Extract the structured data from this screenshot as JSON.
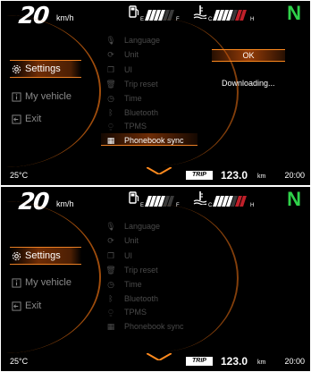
{
  "speed": {
    "value": "20",
    "unit": "km/h"
  },
  "fuel_gauge": {
    "icon": "fuel-pump-icon",
    "empty_label": "E",
    "full_label": "F",
    "filled_bars": 4,
    "total_bars": 6
  },
  "temp_gauge": {
    "icon": "coolant-temp-icon",
    "cold_label": "C",
    "hot_label": "H",
    "filled_bars": 4,
    "total_bars": 7
  },
  "gear": {
    "value": "N",
    "color": "#2fd24a"
  },
  "side_menu": [
    {
      "label": "Settings",
      "icon": "gear-icon",
      "active": true
    },
    {
      "label": "My vehicle",
      "icon": "info-icon",
      "active": false
    },
    {
      "label": "Exit",
      "icon": "exit-icon",
      "active": false
    }
  ],
  "settings_list": [
    {
      "label": "Language",
      "icon": "microphone-icon"
    },
    {
      "label": "Unit",
      "icon": "refresh-icon"
    },
    {
      "label": "UI",
      "icon": "copy-icon"
    },
    {
      "label": "Trip reset",
      "icon": "trash-icon"
    },
    {
      "label": "Time",
      "icon": "clock-icon"
    },
    {
      "label": "Bluetooth",
      "icon": "bluetooth-icon"
    },
    {
      "label": "TPMS",
      "icon": "tire-pressure-icon"
    },
    {
      "label": "Phonebook sync",
      "icon": "phonebook-icon"
    }
  ],
  "dialog": {
    "ok_label": "OK",
    "status_text": "Downloading..."
  },
  "bottom": {
    "temperature": "25°C",
    "trip_label": "TRIP",
    "trip_value": "123.0",
    "trip_unit": "km",
    "clock": "20:00"
  },
  "colors": {
    "accent": "#ff8a1e",
    "background": "#000000",
    "red_zone": "#c0202a"
  }
}
